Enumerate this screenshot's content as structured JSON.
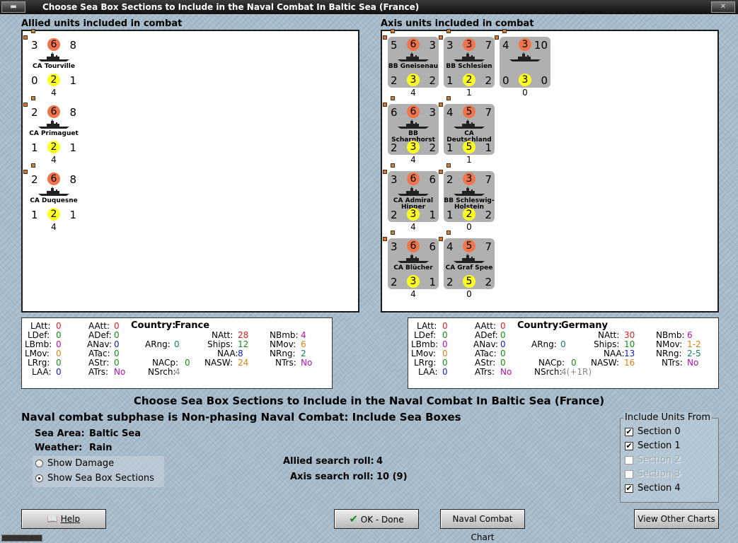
{
  "window": {
    "title": "Choose Sea Box Sections to Include in the Naval Combat In Baltic Sea (France)"
  },
  "allied": {
    "header": "Allied units included in combat",
    "units": [
      {
        "name": "CA Tourville",
        "tl": "3",
        "tc": "6",
        "tr": "8",
        "bl": "0",
        "bc": "2",
        "br": "1",
        "count": "4"
      },
      {
        "name": "CA Primaguet",
        "tl": "2",
        "tc": "6",
        "tr": "8",
        "bl": "1",
        "bc": "2",
        "br": "1",
        "count": "4"
      },
      {
        "name": "CA Duquesne",
        "tl": "2",
        "tc": "6",
        "tr": "8",
        "bl": "1",
        "bc": "2",
        "br": "1",
        "count": "4"
      }
    ]
  },
  "axis": {
    "header": "Axis units included in combat",
    "units": [
      {
        "name": "BB Gneisenau",
        "tl": "5",
        "tc": "6",
        "tr": "3",
        "bl": "2",
        "bc": "3",
        "br": "2",
        "count": "4",
        "tcc": "o",
        "bcc": "y"
      },
      {
        "name": "BB Schlesien",
        "tl": "3",
        "tc": "3",
        "tr": "7",
        "bl": "1",
        "bc": "2",
        "br": "2",
        "count": "1",
        "tcc": "o",
        "bcc": "y"
      },
      {
        "name": "",
        "tl": "4",
        "tc": "3",
        "tr": "10",
        "bl": "0",
        "bc": "3",
        "br": "0",
        "count": "0",
        "tcc": "o",
        "bcc": "y"
      },
      {
        "name": "BB Scharnhorst",
        "tl": "6",
        "tc": "6",
        "tr": "3",
        "bl": "2",
        "bc": "3",
        "br": "2",
        "count": "4",
        "tcc": "o",
        "bcc": "y"
      },
      {
        "name": "CA Deutschland",
        "tl": "4",
        "tc": "5",
        "tr": "7",
        "bl": "1",
        "bc": "5",
        "br": "1",
        "count": "1",
        "tcc": "o",
        "bcc": "y"
      },
      {
        "name": "CA Admiral Hipper",
        "tl": "3",
        "tc": "6",
        "tr": "6",
        "bl": "2",
        "bc": "3",
        "br": "1",
        "count": "4",
        "tcc": "o",
        "bcc": "y"
      },
      {
        "name": "BB Schleswig-Holstein",
        "tl": "2",
        "tc": "3",
        "tr": "7",
        "bl": "1",
        "bc": "2",
        "br": "2",
        "count": "0",
        "tcc": "o",
        "bcc": "y"
      },
      {
        "name": "CA Blücher",
        "tl": "3",
        "tc": "6",
        "tr": "6",
        "bl": "2",
        "bc": "3",
        "br": "1",
        "count": "4",
        "tcc": "o",
        "bcc": "y"
      },
      {
        "name": "CA Graf Spee",
        "tl": "4",
        "tc": "5",
        "tr": "7",
        "bl": "2",
        "bc": "5",
        "br": "2",
        "count": "0",
        "tcc": "o",
        "bcc": "y"
      }
    ]
  },
  "allied_stats": {
    "latt_l": "LAtt:",
    "latt": "0",
    "ldef_l": "LDef:",
    "ldef": "0",
    "lbmb_l": "LBmb:",
    "lbmb": "0",
    "lmov_l": "LMov:",
    "lmov": "0",
    "lrg_l": "LRrg:",
    "lrg": "0",
    "laa_l": "LAA:",
    "laa": "0",
    "aatt_l": "AAtt:",
    "aatt": "0",
    "adef_l": "ADef:",
    "adef": "0",
    "anav_l": "ANav:",
    "anav": "0",
    "atac_l": "ATac:",
    "atac": "0",
    "astr_l": "AStr:",
    "astr": "0",
    "atrs_l": "ATrs:",
    "atrs": "No",
    "country_l": "Country:",
    "country": "France",
    "arng_l": "ARng:",
    "arng": "0",
    "nacp_l": "NACp:",
    "nacp": "0",
    "nsrch_l": "NSrch:",
    "nsrch": "4",
    "natt_l": "NAtt:",
    "natt": "28",
    "ships_l": "Ships:",
    "ships": "12",
    "naa_l": "NAA:",
    "naa": "8",
    "nasw_l": "NASW:",
    "nasw": "24",
    "nbmb_l": "NBmb:",
    "nbmb": "4",
    "nmov_l": "NMov:",
    "nmov": "6",
    "nrng_l": "NRng:",
    "nrng": "2",
    "ntrs_l": "NTrs:",
    "ntrs": "No"
  },
  "axis_stats": {
    "latt_l": "LAtt:",
    "latt": "0",
    "ldef_l": "LDef:",
    "ldef": "0",
    "lbmb_l": "LBmb:",
    "lbmb": "0",
    "lmov_l": "LMov:",
    "lmov": "0",
    "lrg_l": "LRrg:",
    "lrg": "0",
    "laa_l": "LAA:",
    "laa": "0",
    "aatt_l": "AAtt:",
    "aatt": "0",
    "adef_l": "ADef:",
    "adef": "0",
    "anav_l": "ANav:",
    "anav": "0",
    "atac_l": "ATac:",
    "atac": "0",
    "astr_l": "AStr:",
    "astr": "0",
    "atrs_l": "ATrs:",
    "atrs": "No",
    "country_l": "Country:",
    "country": "Germany",
    "arng_l": "ARng:",
    "arng": "0",
    "nacp_l": "NACp:",
    "nacp": "0",
    "nsrch_l": "NSrch:",
    "nsrch": "4(+1R)",
    "natt_l": "NAtt:",
    "natt": "30",
    "ships_l": "Ships:",
    "ships": "10",
    "naa_l": "NAA:",
    "naa": "13",
    "nasw_l": "NASW:",
    "nasw": "16",
    "nbmb_l": "NBmb:",
    "nbmb": "6",
    "nmov_l": "NMov:",
    "nmov": "1-2",
    "nrng_l": "NRng:",
    "nrng": "2-5",
    "ntrs_l": "NTrs:",
    "ntrs": "No"
  },
  "main": {
    "heading": "Choose Sea Box Sections to Include in the Naval Combat In Baltic Sea (France)",
    "subphase": "Naval combat subphase is Non-phasing Naval Combat: Include Sea Boxes",
    "sea_area_label": "Sea Area:",
    "sea_area": "Baltic Sea",
    "weather_label": "Weather:",
    "weather": "Rain",
    "radio_damage": "Show Damage",
    "radio_sections": "Show Sea Box Sections",
    "allied_roll_label": "Allied search roll:",
    "allied_roll": "4",
    "axis_roll_label": "Axis search roll:",
    "axis_roll": "10 (9)"
  },
  "include": {
    "title": "Include Units From",
    "sections": [
      {
        "label": "Section 0",
        "checked": "✔"
      },
      {
        "label": "Section 1",
        "checked": "✔"
      },
      {
        "label": "Section 2",
        "checked": ""
      },
      {
        "label": "Section 3",
        "checked": ""
      },
      {
        "label": "Section 4",
        "checked": "✔"
      }
    ]
  },
  "buttons": {
    "help": "Help",
    "ok": "OK - Done",
    "naval_chart": "Naval Combat Chart",
    "other_charts": "View Other Charts"
  },
  "colors": {
    "allied_counter": "#9cc9ef",
    "axis_counter": "#b0b0b0",
    "attack_circle": "#f0744c",
    "defense_circle": "#ffff22"
  }
}
